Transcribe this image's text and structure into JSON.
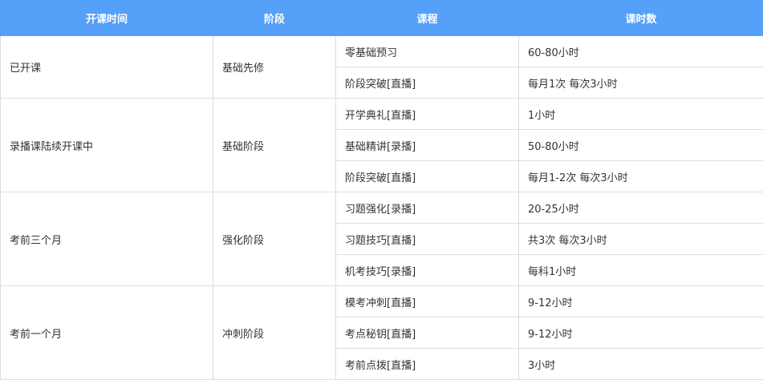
{
  "headers": [
    "开课时间",
    "阶段",
    "课程",
    "课时数"
  ],
  "groups": [
    {
      "time": "已开课",
      "stage": "基础先修",
      "courses": [
        {
          "name": "零基础预习",
          "hours": "60-80小时"
        },
        {
          "name": "阶段突破[直播]",
          "hours": "每月1次 每次3小时"
        }
      ]
    },
    {
      "time": "录播课陆续开课中",
      "stage": "基础阶段",
      "courses": [
        {
          "name": "开学典礼[直播]",
          "hours": "1小时"
        },
        {
          "name": "基础精讲[录播]",
          "hours": "50-80小时"
        },
        {
          "name": "阶段突破[直播]",
          "hours": "每月1-2次 每次3小时"
        }
      ]
    },
    {
      "time": "考前三个月",
      "stage": "强化阶段",
      "courses": [
        {
          "name": "习题强化[录播]",
          "hours": "20-25小时"
        },
        {
          "name": "习题技巧[直播]",
          "hours": "共3次 每次3小时"
        },
        {
          "name": "机考技巧[录播]",
          "hours": "每科1小时"
        }
      ]
    },
    {
      "time": "考前一个月",
      "stage": "冲刺阶段",
      "courses": [
        {
          "name": "模考冲刺[直播]",
          "hours": "9-12小时"
        },
        {
          "name": "考点秘钥[直播]",
          "hours": "9-12小时"
        },
        {
          "name": "考前点拨[直播]",
          "hours": "3小时"
        }
      ]
    }
  ],
  "colors": {
    "header_bg": "#55a0f8",
    "border": "#dddddd"
  }
}
